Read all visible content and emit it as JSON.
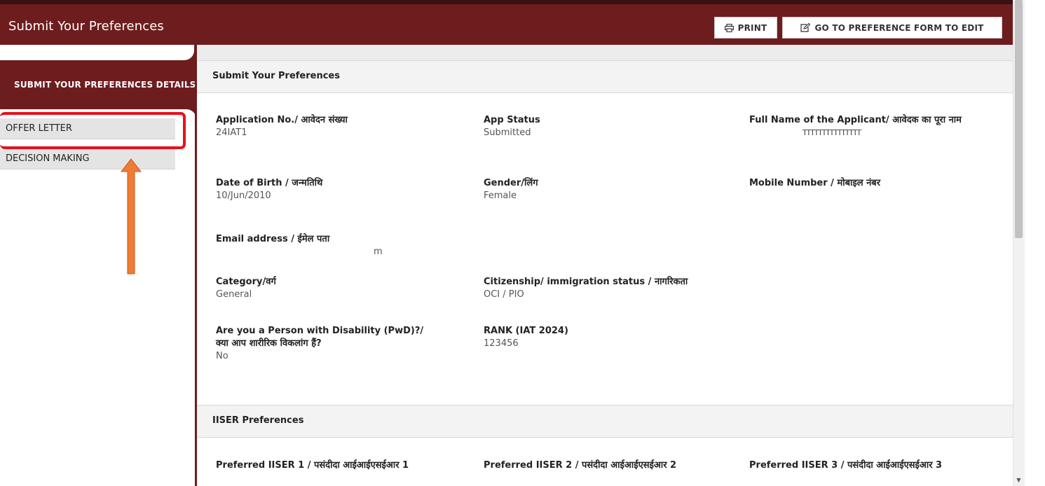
{
  "header": {
    "title": "Submit Your Preferences",
    "print_label": "PRINT",
    "edit_label": "GO TO PREFERENCE FORM TO EDIT"
  },
  "sidebar": {
    "section_label": "SUBMIT YOUR PREFERENCES DETAILS",
    "items": [
      {
        "label": "OFFER LETTER"
      },
      {
        "label": "DECISION MAKING"
      }
    ]
  },
  "section1": {
    "title": "Submit Your Preferences",
    "fields": {
      "application_no": {
        "label": "Application No./ आवेदन संख्या",
        "value": "24IAT1"
      },
      "app_status": {
        "label": "App Status",
        "value": "Submitted"
      },
      "full_name": {
        "label": "Full Name of the Applicant/ आवेदक का पूरा नाम",
        "value": "TTTTTTTTTTTTTTT"
      },
      "dob": {
        "label": "Date of Birth / जन्मतिथि",
        "value": "10/Jun/2010"
      },
      "gender": {
        "label": "Gender/लिंग",
        "value": "Female"
      },
      "mobile": {
        "label": "Mobile Number / मोबाइल नंबर",
        "value": ""
      },
      "email": {
        "label": "Email address / ईमेल पता",
        "value": "m"
      },
      "category": {
        "label": "Category/वर्ग",
        "value": "General"
      },
      "citizenship": {
        "label": "Citizenship/ immigration status / नागरिकता",
        "value": "OCI / PIO"
      },
      "pwd": {
        "label_line1": "Are you a Person with Disability (PwD)?/",
        "label_line2": "क्या आप शारीरिक विकलांग हैं?",
        "value": "No"
      },
      "rank": {
        "label": "RANK (IAT 2024)",
        "value": "123456"
      }
    }
  },
  "section2": {
    "title": "IISER Preferences",
    "fields": {
      "pref1": {
        "label": "Preferred IISER 1 / पसंदीदा आईआईएसईआर 1"
      },
      "pref2": {
        "label": "Preferred IISER 2 / पसंदीदा आईआईएसईआर 2"
      },
      "pref3": {
        "label": "Preferred IISER 3 / पसंदीदा आईआईएसईआर 3"
      }
    }
  },
  "colors": {
    "brand": "#6e1d1f",
    "highlight": "#e8101a",
    "arrow": "#f07b34"
  },
  "icons": {
    "print": "printer-icon",
    "edit": "edit-icon",
    "arrow": "up-arrow-icon"
  }
}
